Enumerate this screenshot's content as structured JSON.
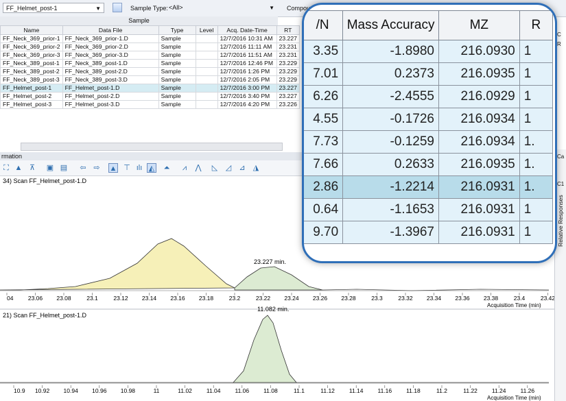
{
  "toolbar": {
    "file_combo": "FF_Helmet_post-1",
    "sample_type_label": "Sample Type:",
    "sample_type_value": "<All>",
    "compound_label": "Compoun"
  },
  "sample_table": {
    "group_header": "Sample",
    "columns": [
      "Name",
      "Data File",
      "Type",
      "Level",
      "Acq. Date-Time",
      "RT"
    ],
    "rows": [
      [
        "FF_Neck_369_prior-1",
        "FF_Neck_369_prior-1.D",
        "Sample",
        "",
        "12/7/2016 10:31 AM",
        "23.227"
      ],
      [
        "FF_Neck_369_prior-2",
        "FF_Neck_369_prior-2.D",
        "Sample",
        "",
        "12/7/2016 11:11 AM",
        "23.231"
      ],
      [
        "FF_Neck_369_prior-3",
        "FF_Neck_369_prior-3.D",
        "Sample",
        "",
        "12/7/2016 11:51 AM",
        "23.231"
      ],
      [
        "FF_Neck_389_post-1",
        "FF_Neck_389_post-1.D",
        "Sample",
        "",
        "12/7/2016 12:46 PM",
        "23.229"
      ],
      [
        "FF_Neck_389_post-2",
        "FF_Neck_389_post-2.D",
        "Sample",
        "",
        "12/7/2016 1:26 PM",
        "23.229"
      ],
      [
        "FF_Neck_389_post-3",
        "FF_Neck_389_post-3.D",
        "Sample",
        "",
        "12/7/2016 2:05 PM",
        "23.229"
      ],
      [
        "FF_Helmet_post-1",
        "FF_Helmet_post-1.D",
        "Sample",
        "",
        "12/7/2016 3:00 PM",
        "23.227"
      ],
      [
        "FF_Helmet_post-2",
        "FF_Helmet_post-2.D",
        "Sample",
        "",
        "12/7/2016 3:40 PM",
        "23.227"
      ],
      [
        "FF_Helmet_post-3",
        "FF_Helmet_post-3.D",
        "Sample",
        "",
        "12/7/2016 4:20 PM",
        "23.226"
      ]
    ],
    "selected_row": 6
  },
  "chromatogram_panel": {
    "header": "rmation",
    "chart1_title": "34) Scan FF_Helmet_post-1.D",
    "chart1_peak_label": "23.227 min.",
    "chart1_ticks": [
      "04",
      "23.06",
      "23.08",
      "23.1",
      "23.12",
      "23.14",
      "23.16",
      "23.18",
      "23.2",
      "23.22",
      "23.24",
      "23.26",
      "23.28",
      "23.3",
      "23.32",
      "23.34",
      "23.36",
      "23.38",
      "23.4",
      "23.42"
    ],
    "chart1_xlabel": "Acquisition Time (min)",
    "chart2_title": "21) Scan FF_Helmet_post-1.D",
    "chart2_peak_label": "11.082 min.",
    "chart2_ticks": [
      "10.9",
      "10.92",
      "10.94",
      "10.96",
      "10.98",
      "11",
      "11.02",
      "11.04",
      "11.06",
      "11.08",
      "11.1",
      "11.12",
      "11.14",
      "11.16",
      "11.18",
      "11.2",
      "11.22",
      "11.24",
      "11.26"
    ],
    "chart2_xlabel": "Acquisition Time (min)"
  },
  "right_panel": {
    "relative_responses_label": "Relative Responses",
    "top_letters": [
      "C",
      "R"
    ],
    "mid_letters": [
      "Ca",
      "C1"
    ]
  },
  "magnified": {
    "columns": [
      "/N",
      "Mass Accuracy",
      "MZ",
      "R"
    ],
    "rows": [
      [
        "3.35",
        "-1.8980",
        "216.0930",
        "1"
      ],
      [
        "7.01",
        "0.2373",
        "216.0935",
        "1"
      ],
      [
        "6.26",
        "-2.4555",
        "216.0929",
        "1"
      ],
      [
        "4.55",
        "-0.1726",
        "216.0934",
        "1"
      ],
      [
        "7.73",
        "-0.1259",
        "216.0934",
        "1."
      ],
      [
        "7.66",
        "0.2633",
        "216.0935",
        "1."
      ],
      [
        "2.86",
        "-1.2214",
        "216.0931",
        "1."
      ],
      [
        "0.64",
        "-1.1653",
        "216.0931",
        "1"
      ],
      [
        "9.70",
        "-1.3967",
        "216.0931",
        "1"
      ]
    ],
    "selected_row": 6
  },
  "colors": {
    "peak_fill_yellow": "#f6f0b8",
    "peak_fill_green": "#dcebd2",
    "callout_border": "#2f6fb8",
    "row_highlight": "#d5ecf3"
  }
}
